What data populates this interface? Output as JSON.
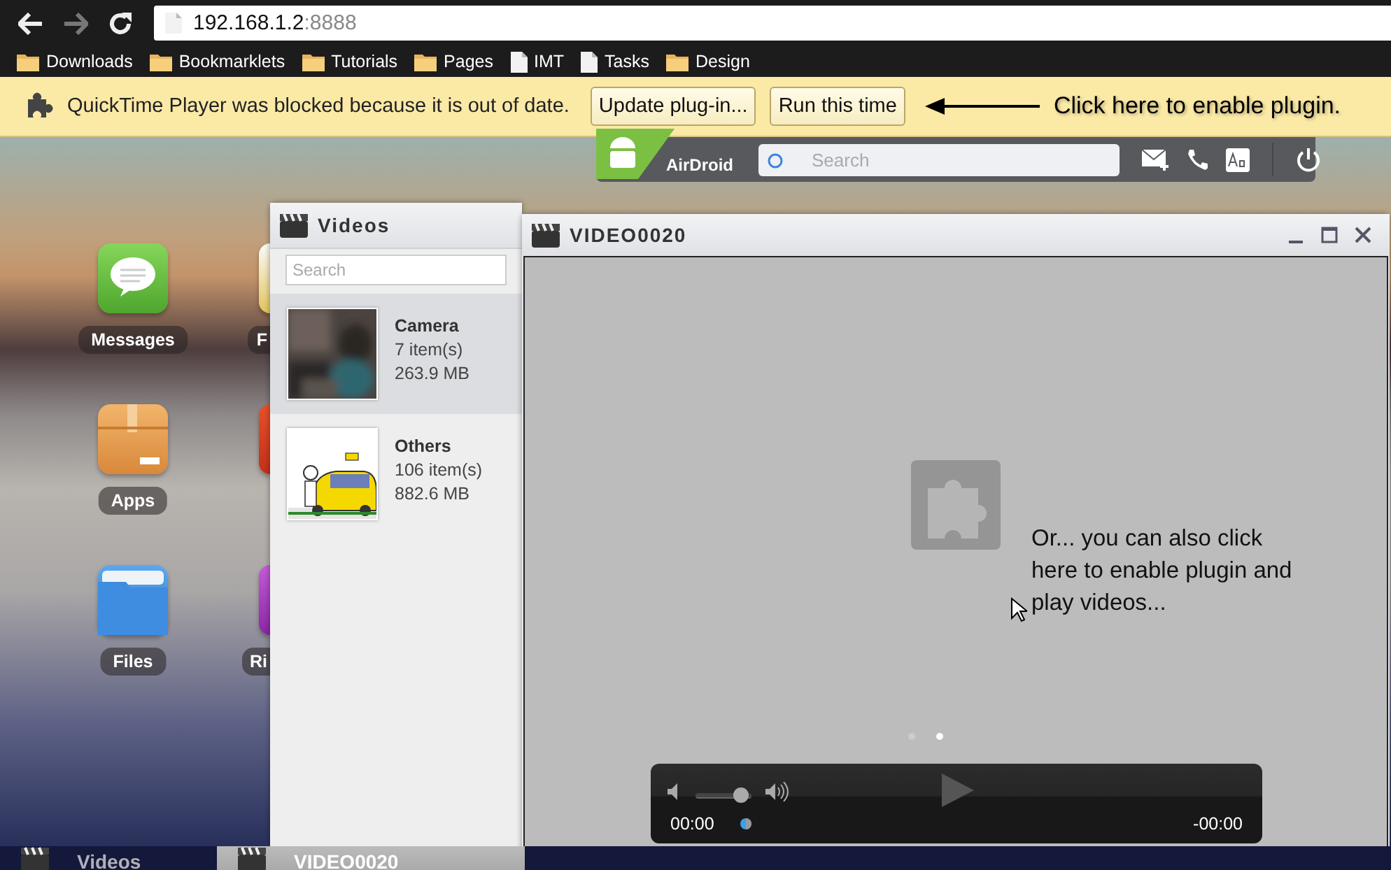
{
  "browser": {
    "address": {
      "host": "192.168.1.2",
      "port": ":8888"
    },
    "bookmarks": [
      {
        "kind": "folder",
        "label": "Downloads"
      },
      {
        "kind": "folder",
        "label": "Bookmarklets"
      },
      {
        "kind": "folder",
        "label": "Tutorials"
      },
      {
        "kind": "folder",
        "label": "Pages"
      },
      {
        "kind": "page",
        "label": "IMT"
      },
      {
        "kind": "page",
        "label": "Tasks"
      },
      {
        "kind": "folder",
        "label": "Design"
      }
    ]
  },
  "infobar": {
    "message": "QuickTime Player was blocked because it is out of date.",
    "buttons": [
      "Update plug-in...",
      "Run this time"
    ],
    "annotation": "Click here to enable plugin."
  },
  "airdroid": {
    "logo": "AirDroid",
    "search": {
      "placeholder": "Search"
    }
  },
  "desktop_icons": [
    {
      "kind": "messages",
      "label": "Messages"
    },
    {
      "kind": "apps",
      "label": "Apps"
    },
    {
      "kind": "files",
      "label": "Files"
    },
    {
      "kind": "photos",
      "label": "F"
    },
    {
      "kind": "tools"
    },
    {
      "kind": "ringtones",
      "label": "Ri"
    }
  ],
  "videos_window": {
    "title": "Videos",
    "search": {
      "placeholder": "Search"
    },
    "folders": [
      {
        "name": "Camera",
        "count": "7 item(s)",
        "size": "263.9 MB",
        "selected": true
      },
      {
        "name": "Others",
        "count": "106 item(s)",
        "size": "882.6 MB",
        "selected": false
      }
    ]
  },
  "player_window": {
    "title": "VIDEO0020",
    "annotation": "Or... you can also click here to enable plugin and play videos...",
    "pages": [
      {
        "selected": false
      },
      {
        "selected": true
      }
    ],
    "volume": {
      "level": 0.8
    },
    "time_elapsed": "00:00",
    "time_remaining": "-00:00"
  },
  "taskbar": [
    {
      "label": "Videos",
      "selected": false
    },
    {
      "label": "VIDEO0020",
      "selected": true
    }
  ]
}
